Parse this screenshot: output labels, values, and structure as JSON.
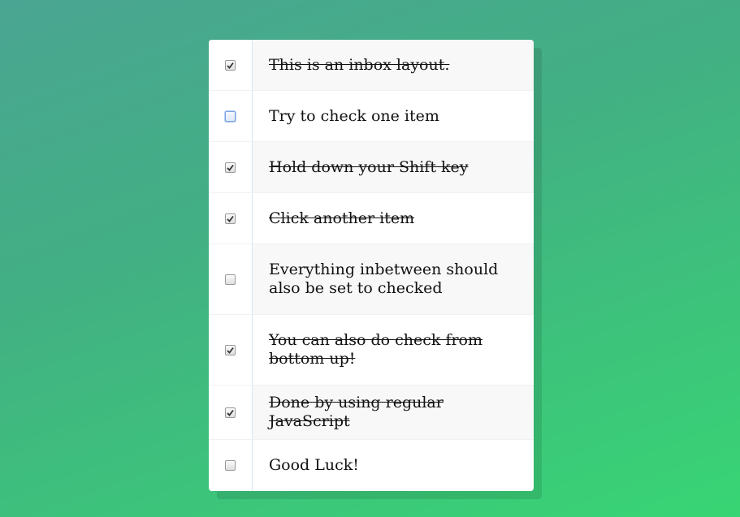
{
  "inbox": {
    "items": [
      {
        "label": "This is an inbox layout.",
        "checked": true
      },
      {
        "label": "Try to check one item",
        "checked": false
      },
      {
        "label": "Hold down your Shift key",
        "checked": true
      },
      {
        "label": "Click another item",
        "checked": true
      },
      {
        "label": "Everything inbetween should also be set to checked",
        "checked": false
      },
      {
        "label": "You can also do check from bottom up!",
        "checked": true
      },
      {
        "label": "Done by using regular JavaScript",
        "checked": true
      },
      {
        "label": "Good Luck!",
        "checked": false
      }
    ]
  },
  "icons": {
    "checkmark": "check-icon"
  }
}
